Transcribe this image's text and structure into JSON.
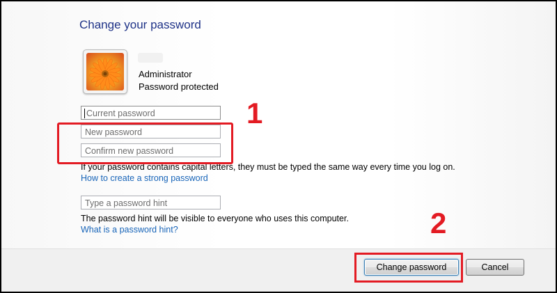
{
  "page": {
    "title": "Change your password"
  },
  "user": {
    "name": "Administrator",
    "status": "Password protected",
    "avatar_icon": "orange-flower-picture"
  },
  "form": {
    "current_password_placeholder": "Current password",
    "new_password_placeholder": "New password",
    "confirm_password_placeholder": "Confirm new password",
    "caps_note": "If your password contains capital letters, they must be typed the same way every time you log on.",
    "strong_password_link": "How to create a strong password",
    "hint_placeholder": "Type a password hint",
    "hint_note": "The password hint will be visible to everyone who uses this computer.",
    "hint_link": "What is a password hint?"
  },
  "buttons": {
    "change_password": "Change password",
    "cancel": "Cancel"
  },
  "annotations": {
    "step1": "1",
    "step2": "2",
    "color": "#e31b23"
  }
}
